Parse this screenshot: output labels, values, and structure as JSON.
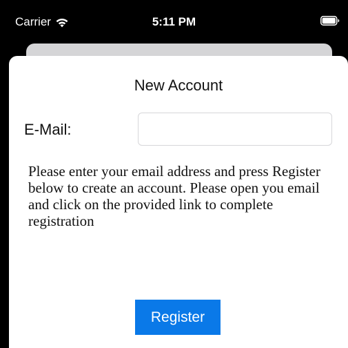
{
  "status_bar": {
    "carrier": "Carrier",
    "time": "5:11 PM",
    "wifi_icon": "wifi-icon",
    "battery_icon": "battery-full-icon"
  },
  "sheet": {
    "title": "New Account",
    "email_label": "E-Mail:",
    "email_value": "",
    "email_placeholder": "",
    "instructions": "Please enter your email address and press Register below to create an account. Please open you email and click on the provided link to complete registration",
    "register_label": "Register"
  },
  "colors": {
    "background": "#000000",
    "sheet": "#ffffff",
    "back_card": "#d5d5d7",
    "accent": "#0a79e8"
  }
}
